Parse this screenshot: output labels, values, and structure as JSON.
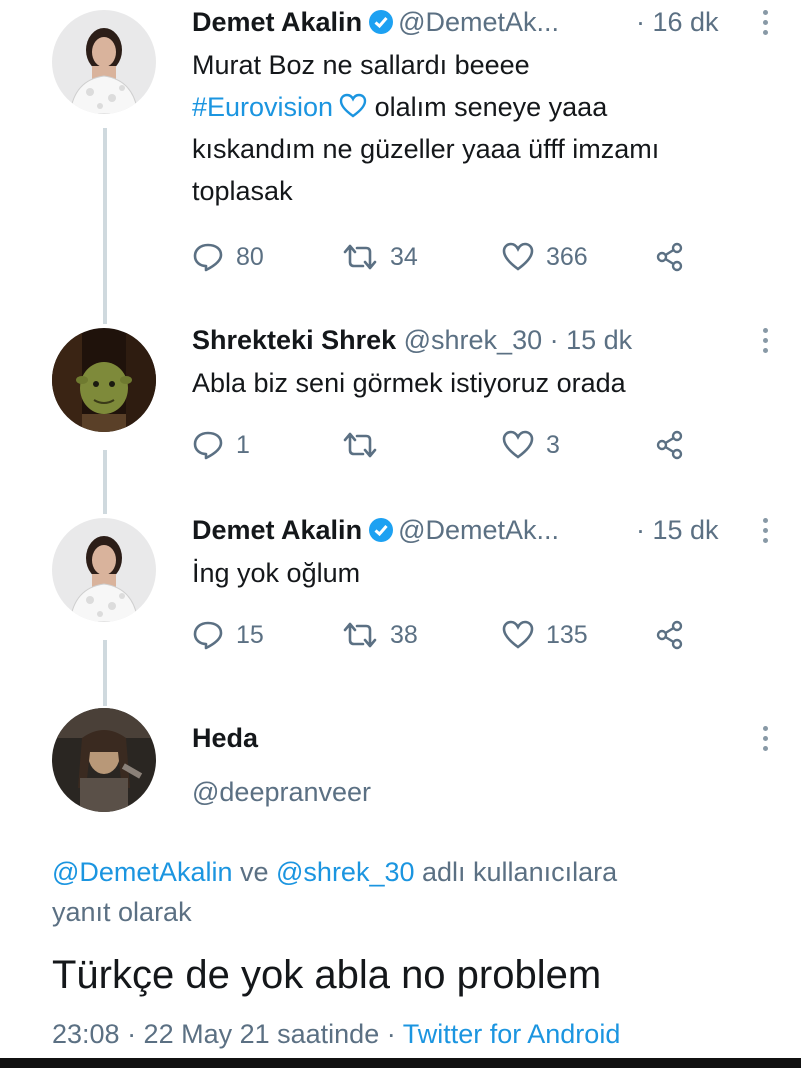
{
  "tweets": [
    {
      "name": "Demet Akalin",
      "handle": "@DemetAk...",
      "time": "· 16 dk",
      "text_line1": "Murat Boz ne sallardı beeee",
      "hashtag": "#Eurovision",
      "text_line2_rest": " olalım seneye yaaa",
      "text_line3": "kıskandım ne güzeller yaaa üfff imzamı",
      "text_line4": "toplasak",
      "replies": "80",
      "retweets": "34",
      "likes": "366"
    },
    {
      "name": "Shrekteki Shrek",
      "handle": "@shrek_30",
      "time": "· 15 dk",
      "text": "Abla biz seni görmek istiyoruz orada",
      "replies": "1",
      "retweets": "",
      "likes": "3"
    },
    {
      "name": "Demet Akalin",
      "handle": "@DemetAk...",
      "time": "· 15 dk",
      "text": "İng yok oğlum",
      "replies": "15",
      "retweets": "38",
      "likes": "135"
    }
  ],
  "focused": {
    "name": "Heda",
    "handle": "@deepranveer",
    "reply_mention_1": "@DemetAkalin",
    "reply_connector": " ve ",
    "reply_mention_2": "@shrek_30",
    "reply_suffix_1": " adlı kullanıcılara",
    "reply_suffix_2": "yanıt olarak",
    "text": "Türkçe de yok abla no problem",
    "timestamp": "23:08 · 22 May 21 saatinde · ",
    "source": "Twitter for Android"
  },
  "colors": {
    "link": "#1b95e0",
    "muted": "#5b7083",
    "verified": "#1da1f2"
  }
}
